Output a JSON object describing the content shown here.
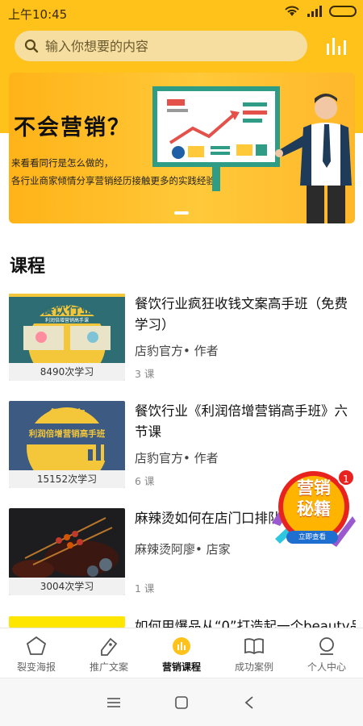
{
  "status": {
    "time": "上午10:45"
  },
  "search": {
    "placeholder": "输入你想要的内容"
  },
  "banner": {
    "title": "不会营销？",
    "line1": "来看看同行是怎么做的，",
    "line2": "各行业商家倾情分享营销经历接触更多的实践经验！"
  },
  "section": {
    "title": "课程"
  },
  "courses": [
    {
      "title": "餐饮行业疯狂收钱文案高手班（免费学习）",
      "author": "店豹官方• 作者",
      "lessons": "3 课",
      "views": "8490次学习",
      "thumb_text": "餐饮行业",
      "thumb_sub": "利润倍增营销高手课"
    },
    {
      "title": "餐饮行业《利润倍增营销高手班》六节课",
      "author": "店豹官方• 作者",
      "lessons": "6 课",
      "views": "15152次学习",
      "thumb_text": "餐饮店",
      "thumb_sub": "利润倍增营销高手班"
    },
    {
      "title": "麻辣烫如何在店门口排队",
      "author": "麻辣烫阿廖• 店家",
      "lessons": "1 课",
      "views": "3004次学习"
    },
    {
      "title": "如何用爆品从“0”打造起一个beauty品"
    }
  ],
  "promo": {
    "line1": "营销",
    "line2": "秘籍",
    "sub": "立即查看",
    "count": "1"
  },
  "tabs": [
    {
      "label": "裂变海报"
    },
    {
      "label": "推广文案"
    },
    {
      "label": "营销课程"
    },
    {
      "label": "成功案例"
    },
    {
      "label": "个人中心"
    }
  ],
  "colors": {
    "brand": "#ffc21a",
    "badge": "#e8231f"
  }
}
